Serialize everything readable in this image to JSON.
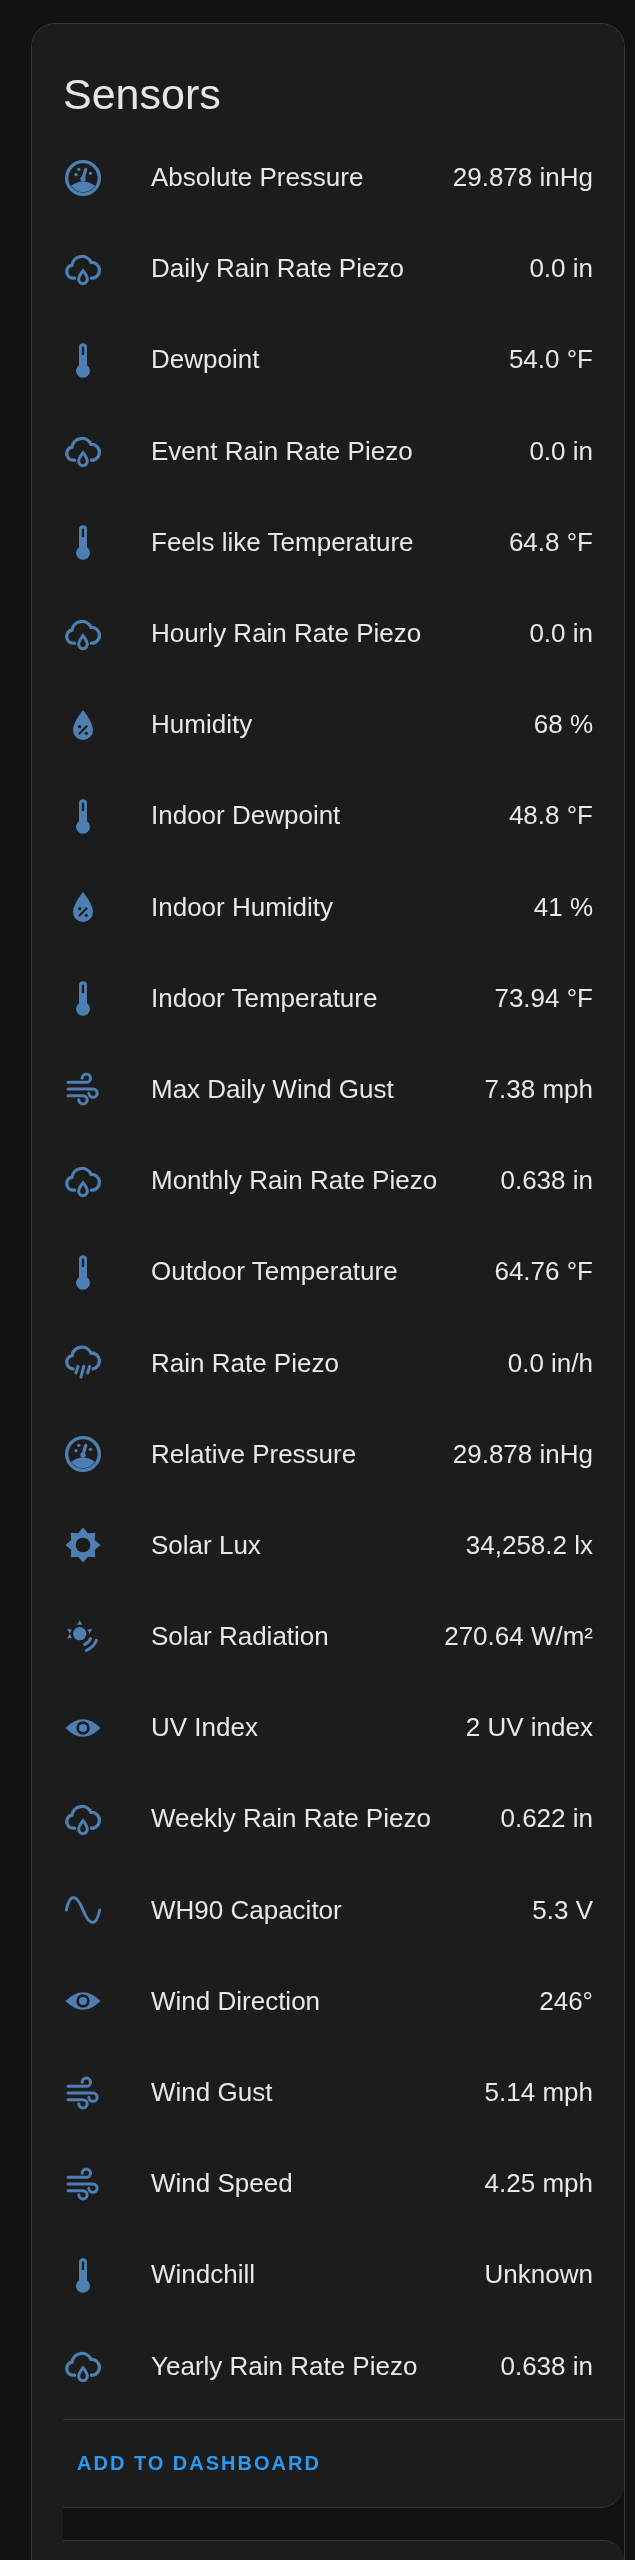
{
  "card": {
    "title": "Sensors",
    "rows": [
      {
        "kind": "gauge",
        "name": "Absolute Pressure",
        "value": "29.878 inHg"
      },
      {
        "kind": "rain_cloud",
        "name": "Daily Rain Rate Piezo",
        "value": "0.0 in"
      },
      {
        "kind": "thermometer",
        "name": "Dewpoint",
        "value": "54.0 °F"
      },
      {
        "kind": "rain_cloud",
        "name": "Event Rain Rate Piezo",
        "value": "0.0 in"
      },
      {
        "kind": "thermometer",
        "name": "Feels like Temperature",
        "value": "64.8 °F"
      },
      {
        "kind": "rain_cloud",
        "name": "Hourly Rain Rate Piezo",
        "value": "0.0 in"
      },
      {
        "kind": "humidity",
        "name": "Humidity",
        "value": "68 %"
      },
      {
        "kind": "thermometer",
        "name": "Indoor Dewpoint",
        "value": "48.8 °F"
      },
      {
        "kind": "humidity",
        "name": "Indoor Humidity",
        "value": "41 %"
      },
      {
        "kind": "thermometer",
        "name": "Indoor Temperature",
        "value": "73.94 °F"
      },
      {
        "kind": "wind",
        "name": "Max Daily Wind Gust",
        "value": "7.38 mph"
      },
      {
        "kind": "rain_cloud",
        "name": "Monthly Rain Rate Piezo",
        "value": "0.638 in"
      },
      {
        "kind": "thermometer",
        "name": "Outdoor Temperature",
        "value": "64.76 °F"
      },
      {
        "kind": "pouring",
        "name": "Rain Rate Piezo",
        "value": "0.0 in/h"
      },
      {
        "kind": "gauge",
        "name": "Relative Pressure",
        "value": "29.878 inHg"
      },
      {
        "kind": "sun",
        "name": "Solar Lux",
        "value": "34,258.2 lx"
      },
      {
        "kind": "radiation",
        "name": "Solar Radiation",
        "value": "270.64 W/m²"
      },
      {
        "kind": "eye",
        "name": "UV Index",
        "value": "2 UV index"
      },
      {
        "kind": "rain_cloud",
        "name": "Weekly Rain Rate Piezo",
        "value": "0.622 in"
      },
      {
        "kind": "sine",
        "name": "WH90 Capacitor",
        "value": "5.3 V"
      },
      {
        "kind": "eye",
        "name": "Wind Direction",
        "value": "246°"
      },
      {
        "kind": "wind",
        "name": "Wind Gust",
        "value": "5.14 mph"
      },
      {
        "kind": "wind",
        "name": "Wind Speed",
        "value": "4.25 mph"
      },
      {
        "kind": "thermometer",
        "name": "Windchill",
        "value": "Unknown"
      },
      {
        "kind": "rain_cloud",
        "name": "Yearly Rain Rate Piezo",
        "value": "0.638 in"
      }
    ],
    "action": "ADD TO DASHBOARD"
  }
}
